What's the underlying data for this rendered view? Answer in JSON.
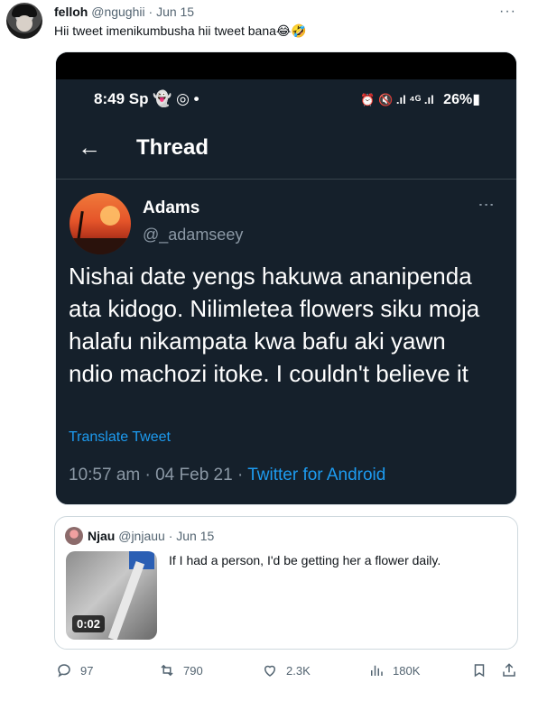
{
  "tweet": {
    "author_name": "felloh",
    "author_handle": "@ngughii",
    "separator": "·",
    "date": "Jun 15",
    "text": "Hii tweet imenikumbusha hii tweet bana😂🤣",
    "more_label": "···"
  },
  "screenshot": {
    "status_time": "8:49 Sp 👻 ◎ •",
    "status_right_icons": "⏰ 🔇 .ıl ⁴ᴳ .ıl",
    "battery": "26%▮",
    "back_label": "←",
    "title": "Thread",
    "author_name": "Adams",
    "author_handle": "@_adamseey",
    "more_label": "⋮",
    "body": "Nishai date yengs hakuwa ananipenda ata kidogo. Nilimletea flowers siku moja halafu nikampata kwa bafu aki yawn ndio machozi itoke. I couldn't believe it",
    "translate_label": "Translate Tweet",
    "meta_time": "10:57 am · 04 Feb 21 · ",
    "meta_source": "Twitter for Android"
  },
  "quote": {
    "author_name": "Njau",
    "author_handle": "@jnjauu",
    "separator": "·",
    "date": "Jun 15",
    "text": "If I had a person, I'd be getting her a flower daily.",
    "video_duration": "0:02"
  },
  "actions": {
    "replies": "97",
    "retweets": "790",
    "likes": "2.3K",
    "views": "180K"
  },
  "colors": {
    "accent": "#1d9bf0",
    "dark_bg": "#15202b",
    "muted": "#536471"
  }
}
